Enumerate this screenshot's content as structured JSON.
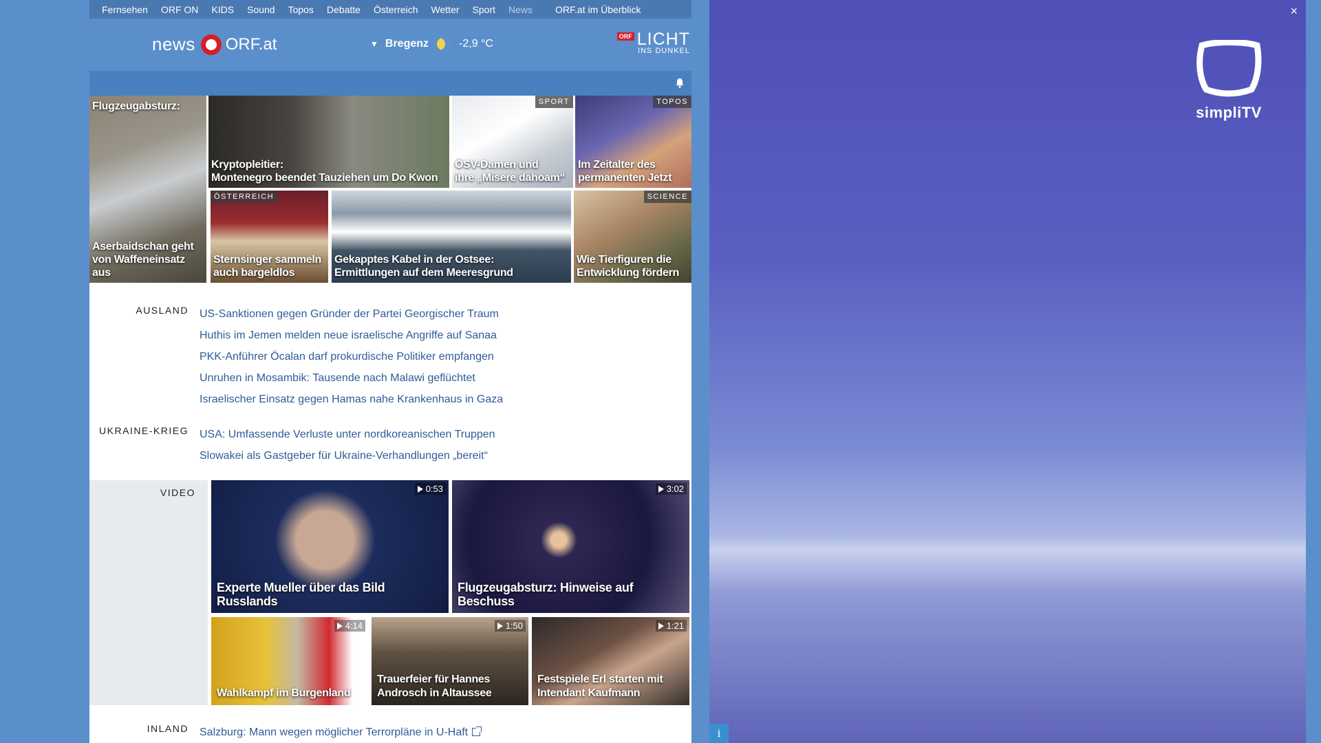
{
  "nav": {
    "items": [
      "Fernsehen",
      "ORF ON",
      "KIDS",
      "Sound",
      "Topos",
      "Debatte",
      "Österreich",
      "Wetter",
      "Sport"
    ],
    "current": "News",
    "overview": "ORF.at im Überblick"
  },
  "header": {
    "logo_news": "news",
    "logo_orf": "ORF.at",
    "weather_city": "Bregenz",
    "weather_temp": "-2,9 °C",
    "licht_badge": "ORF",
    "licht_big": "LICHT",
    "licht_small": "INS DUNKEL"
  },
  "teasers": {
    "t1_top": "Flugzeugabsturz:",
    "t1": "Aserbaidschan geht von Waffeneinsatz aus",
    "t2_a": "Kryptopleitier:",
    "t2_b": "Montenegro beendet Tauziehen um Do Kwon",
    "t3_tag": "SPORT",
    "t3_a": "ÖSV-Damen und",
    "t3_b": "ihre „Misere dahoam“",
    "t4_tag": "TOPOS",
    "t4_a": "Im Zeitalter des",
    "t4_b": "permanenten Jetzt",
    "t5_tag": "ÖSTERREICH",
    "t5_a": "Sternsinger sammeln",
    "t5_b": "auch bargeldlos",
    "t6_a": "Gekapptes Kabel in der Ostsee:",
    "t6_b": "Ermittlungen auf dem Meeresgrund",
    "t7_tag": "SCIENCE",
    "t7_a": "Wie Tierfiguren die",
    "t7_b": "Entwicklung fördern"
  },
  "ausland": {
    "label": "AUSLAND",
    "items": [
      "US-Sanktionen gegen Gründer der Partei Georgischer Traum",
      "Huthis im Jemen melden neue israelische Angriffe auf Sanaa",
      "PKK-Anführer Öcalan darf prokurdische Politiker empfangen",
      "Unruhen in Mosambik: Tausende nach Malawi geflüchtet",
      "Israelischer Einsatz gegen Hamas nahe Krankenhaus in Gaza"
    ]
  },
  "ukraine": {
    "label": "UKRAINE-KRIEG",
    "items": [
      "USA: Umfassende Verluste unter nordkoreanischen Truppen",
      "Slowakei als Gastgeber für Ukraine-Verhandlungen „bereit“"
    ]
  },
  "video": {
    "label": "VIDEO",
    "v1_dur": "0:53",
    "v1": "Experte Mueller über das Bild Russlands",
    "v2_dur": "3:02",
    "v2": "Flugzeugabsturz: Hinweise auf Beschuss",
    "v3_dur": "4:14",
    "v3": "Wahlkampf im Burgenland",
    "v4_dur": "1:50",
    "v4_a": "Trauerfeier für Hannes",
    "v4_b": "Androsch in Altaussee",
    "v5_dur": "1:21",
    "v5_a": "Festspiele Erl starten mit",
    "v5_b": "Intendant Kaufmann"
  },
  "inland": {
    "label": "INLAND",
    "items": [
      "Salzburg: Mann wegen möglicher Terrorpläne in U-Haft"
    ]
  },
  "simplitv": {
    "close": "×",
    "brand": "simpliTV",
    "info": "i"
  }
}
